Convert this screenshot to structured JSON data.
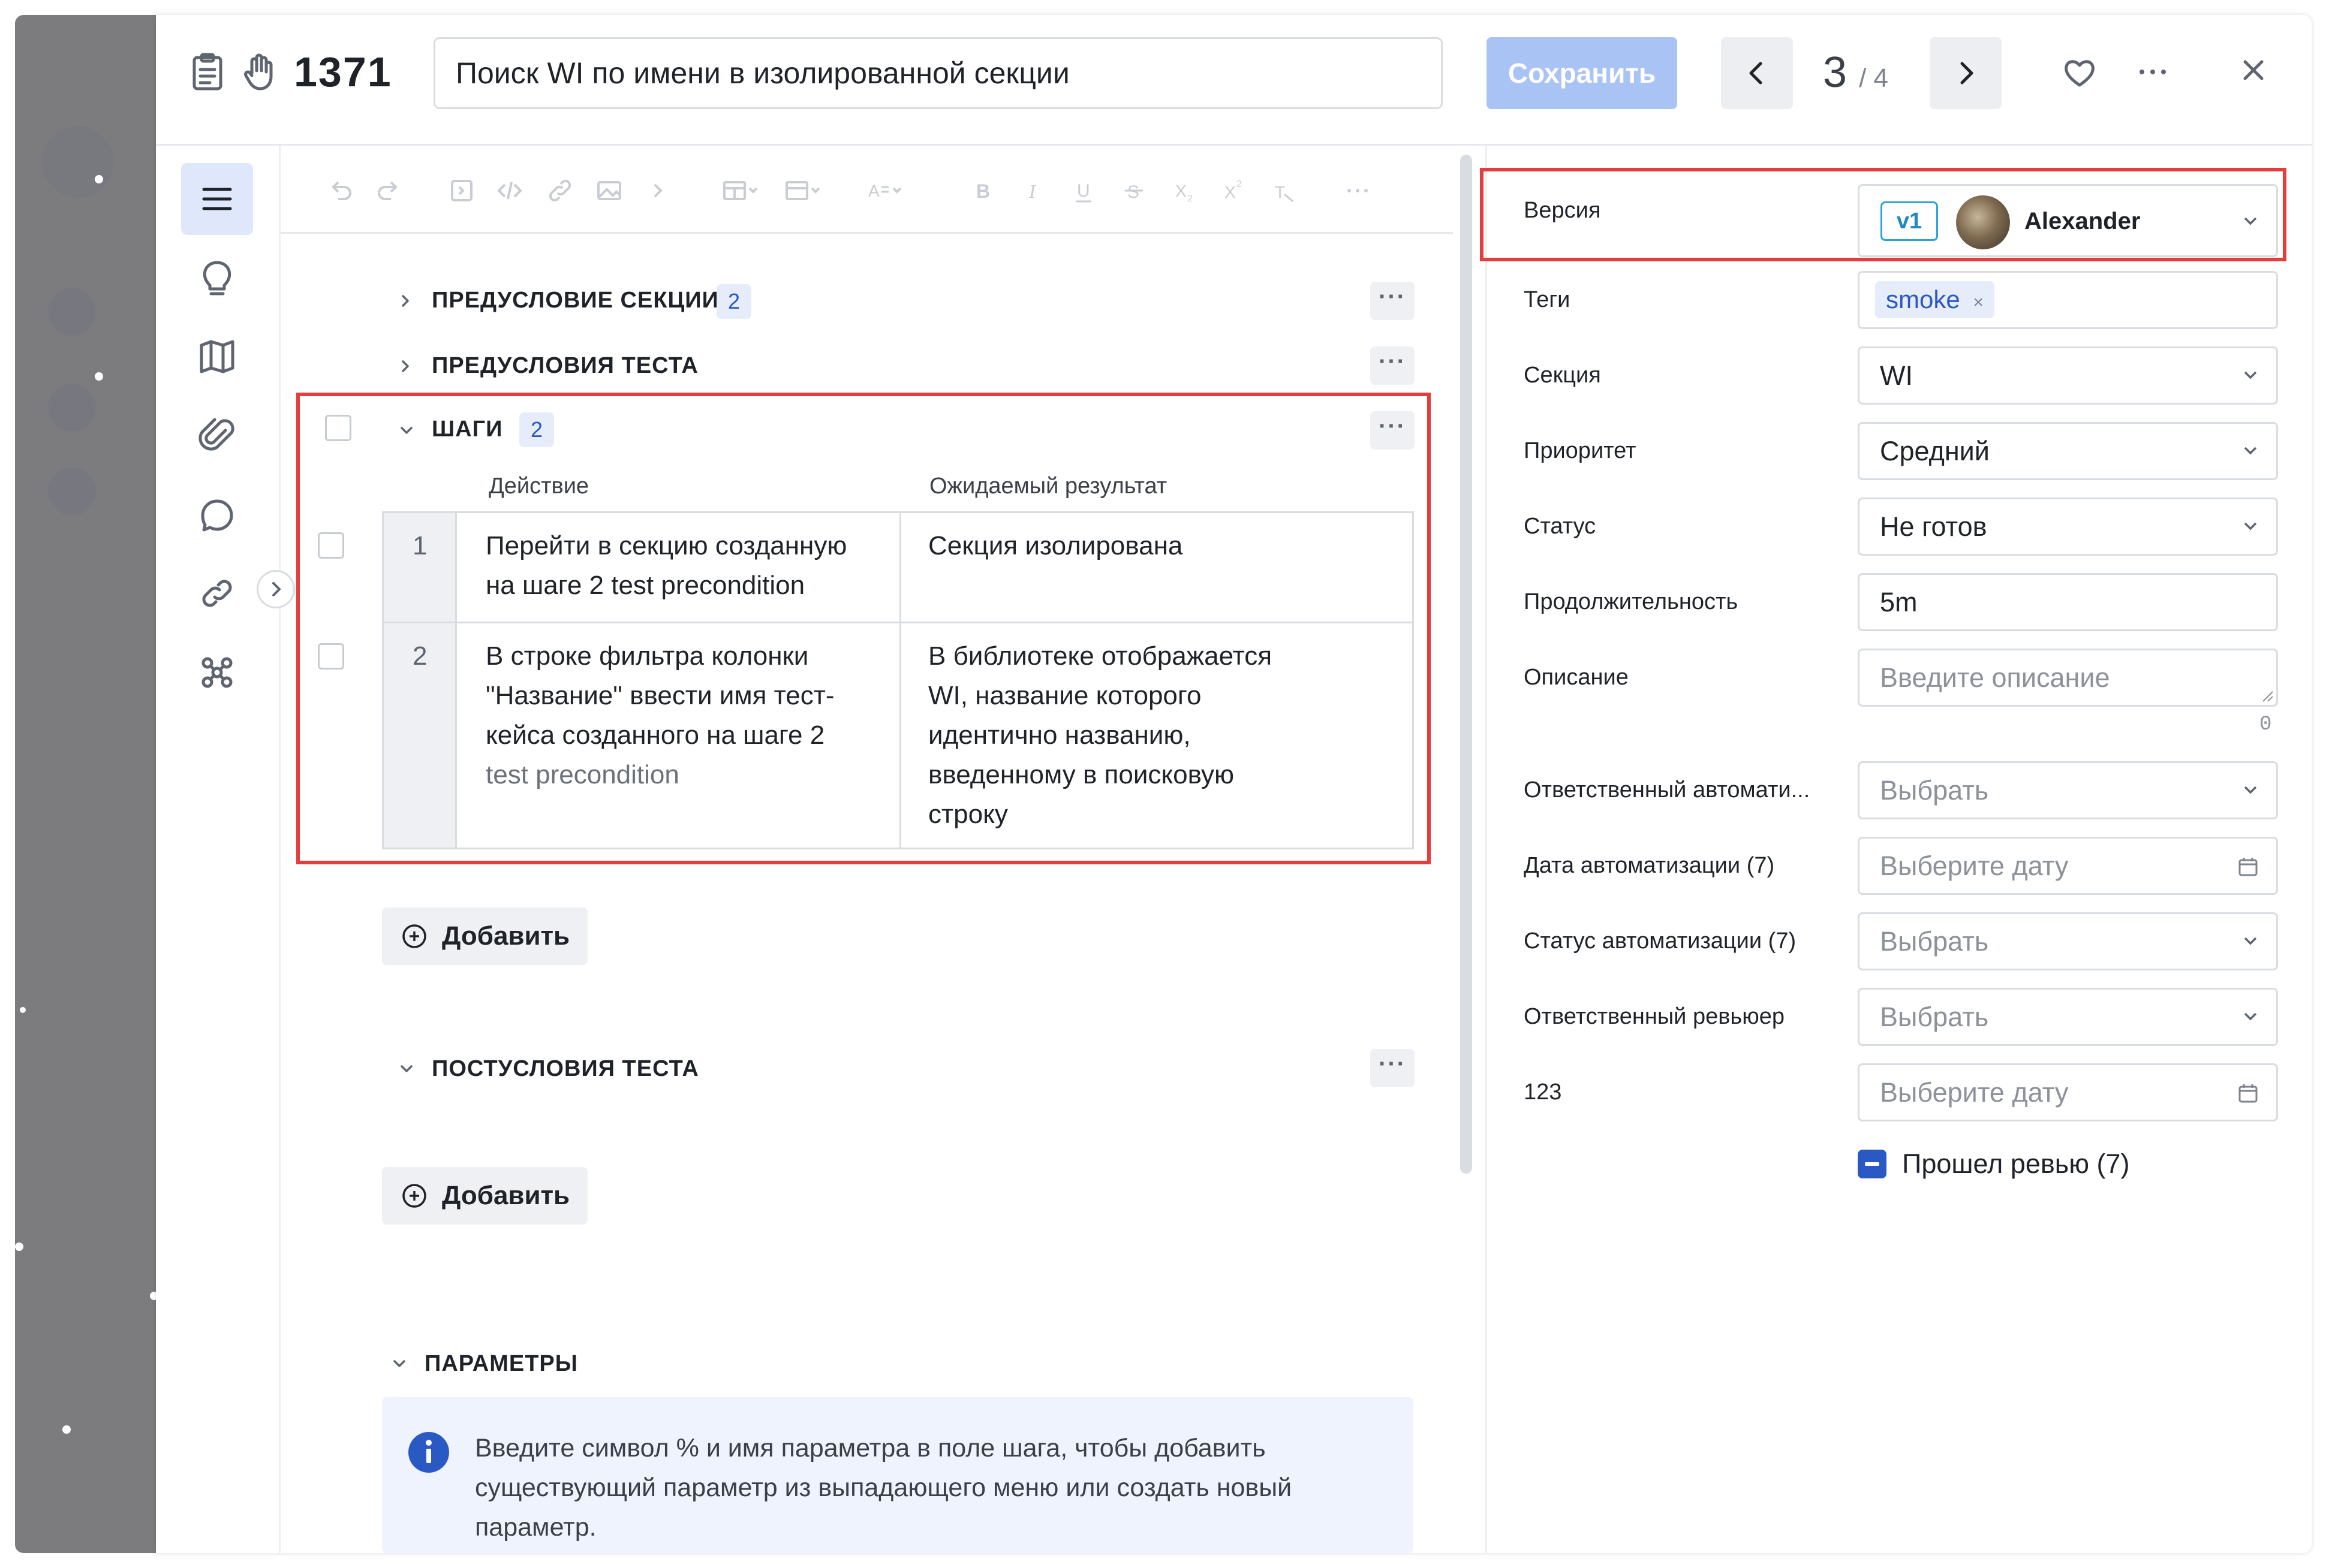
{
  "header": {
    "case_id": "1371",
    "title_value": "Поиск WI по имени в изолированной секции",
    "save_label": "Сохранить",
    "counter_current": "3",
    "counter_total": "/ 4"
  },
  "editor": {
    "sections": {
      "section_precondition": {
        "title": "ПРЕДУСЛОВИЕ СЕКЦИИ",
        "count": "2"
      },
      "test_preconditions": {
        "title": "ПРЕДУСЛОВИЯ ТЕСТА"
      },
      "steps": {
        "title": "ШАГИ",
        "count": "2"
      },
      "postconditions": {
        "title": "ПОСТУСЛОВИЯ ТЕСТА"
      },
      "parameters": {
        "title": "ПАРАМЕТРЫ"
      }
    },
    "steps_table": {
      "headers": [
        "Действие",
        "Ожидаемый результат"
      ],
      "rows": [
        {
          "num": "1",
          "action": [
            "Перейти в секцию созданную",
            "на шаге 2 test precondition"
          ],
          "result": [
            "Секция изолирована"
          ]
        },
        {
          "num": "2",
          "action": [
            "В строке фильтра колонки",
            "\"Название\" ввести имя тест-",
            "кейса созданного на шаге 2",
            "test precondition"
          ],
          "result": [
            "В библиотеке отображается",
            "WI, название которого",
            "идентично названию,",
            "введенному в поисковую",
            "строку"
          ]
        }
      ]
    },
    "add_label": "Добавить",
    "info_text": [
      "Введите символ % и имя параметра в поле шага, чтобы добавить",
      "существующий параметр из выпадающего меню или создать новый",
      "параметр."
    ]
  },
  "panel": {
    "version": {
      "label": "Версия",
      "badge": "v1",
      "user": "Alexander"
    },
    "tags": {
      "label": "Теги",
      "tag": "smoke"
    },
    "section": {
      "label": "Секция",
      "value": "WI"
    },
    "priority": {
      "label": "Приоритет",
      "value": "Средний"
    },
    "status": {
      "label": "Статус",
      "value": "Не готов"
    },
    "duration": {
      "label": "Продолжительность",
      "value": "5m"
    },
    "description": {
      "label": "Описание",
      "placeholder": "Введите описание",
      "char_count": "0"
    },
    "automation_owner": {
      "label": "Ответственный автомати...",
      "placeholder": "Выбрать"
    },
    "automation_date": {
      "label": "Дата автоматизации (7)",
      "placeholder": "Выберите дату"
    },
    "automation_status": {
      "label": "Статус автоматизации (7)",
      "placeholder": "Выбрать"
    },
    "reviewer": {
      "label": "Ответственный ревьюер",
      "placeholder": "Выбрать"
    },
    "custom_123": {
      "label": "123",
      "placeholder": "Выберите дату"
    },
    "reviewed": {
      "label": "Прошел ревью (7)"
    }
  },
  "colors": {
    "accent": "#2b59c3",
    "highlight": "#e53d3d",
    "save_disabled": "#aac3f5"
  }
}
